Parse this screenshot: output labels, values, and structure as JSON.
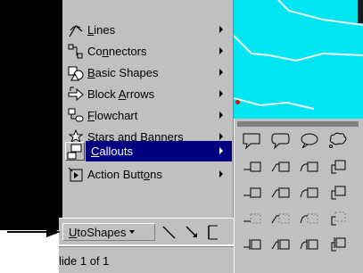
{
  "menu": {
    "items": [
      {
        "pre": "",
        "ul": "L",
        "post": "ines",
        "icon": "lines-icon",
        "has_submenu": true,
        "selected": false
      },
      {
        "pre": "Co",
        "ul": "n",
        "post": "nectors",
        "icon": "connectors-icon",
        "has_submenu": true,
        "selected": false
      },
      {
        "pre": "",
        "ul": "B",
        "post": "asic Shapes",
        "icon": "basic-shapes-icon",
        "has_submenu": true,
        "selected": false
      },
      {
        "pre": "Block ",
        "ul": "A",
        "post": "rrows",
        "icon": "block-arrows-icon",
        "has_submenu": true,
        "selected": false
      },
      {
        "pre": "",
        "ul": "F",
        "post": "lowchart",
        "icon": "flowchart-icon",
        "has_submenu": true,
        "selected": false
      },
      {
        "pre": "",
        "ul": "S",
        "post": "tars and Banners",
        "icon": "stars-banners-icon",
        "has_submenu": true,
        "selected": false
      },
      {
        "pre": "",
        "ul": "C",
        "post": "allouts",
        "icon": "callouts-icon",
        "has_submenu": true,
        "selected": true
      },
      {
        "pre": "Action Butt",
        "ul": "o",
        "post": "ns",
        "icon": "action-buttons-icon",
        "has_submenu": true,
        "selected": false
      }
    ]
  },
  "toolbar": {
    "autoshapes_pre": "",
    "autoshapes_ul": "U",
    "autoshapes_post": "toShapes",
    "autoshapes_full": "AutoShapes"
  },
  "status": {
    "text": "lide 1 of 1"
  },
  "callouts_palette": {
    "rows": [
      [
        "rectangular-callout-icon",
        "rounded-callout-icon",
        "oval-callout-icon",
        "cloud-callout-icon"
      ],
      [
        "line-callout-1-icon",
        "line-callout-2-icon",
        "line-callout-3-icon",
        "line-callout-4-icon"
      ],
      [
        "line-callout-1-accent-icon",
        "line-callout-2-accent-icon",
        "line-callout-3-accent-icon",
        "line-callout-4-accent-icon"
      ],
      [
        "line-callout-1-noborder-icon",
        "line-callout-2-noborder-icon",
        "line-callout-3-noborder-icon",
        "line-callout-4-noborder-icon"
      ],
      [
        "line-callout-1-border-accent-icon",
        "line-callout-2-border-accent-icon",
        "line-callout-3-border-accent-icon",
        "line-callout-4-border-accent-icon"
      ]
    ]
  },
  "colors": {
    "menu_bg": "#c0c0c0",
    "selection": "#000080",
    "slide_bg": "#00e5f2"
  }
}
